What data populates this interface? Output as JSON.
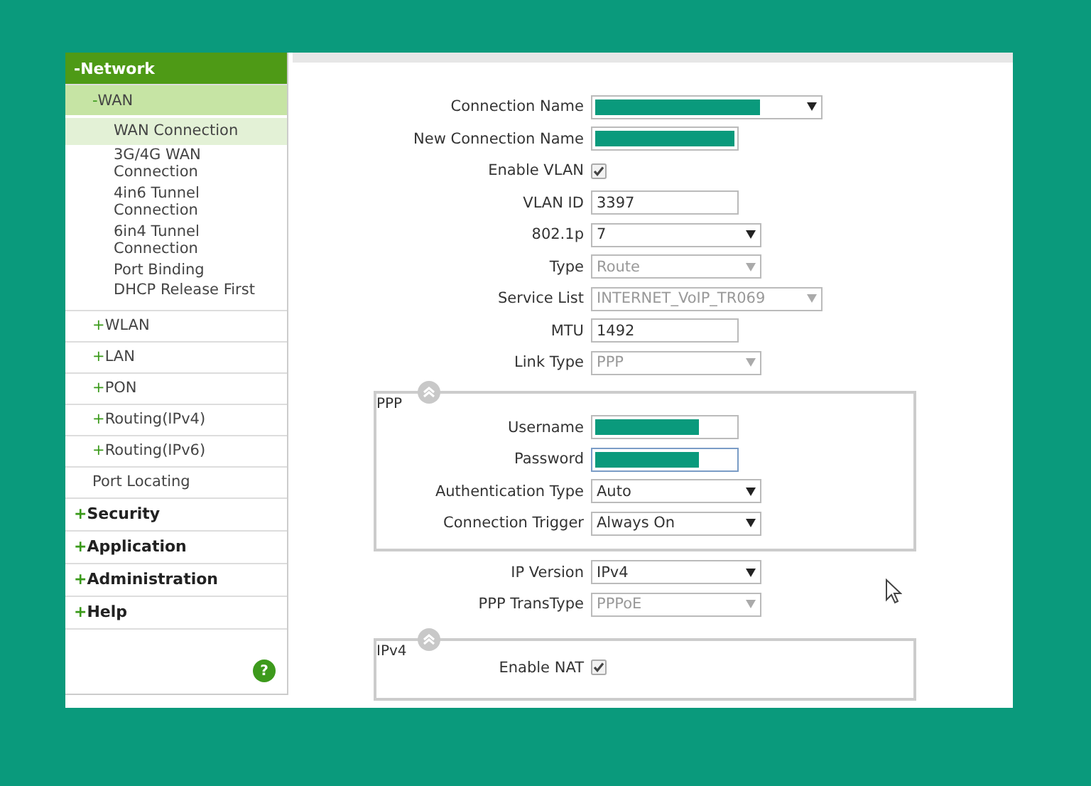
{
  "sidebar": {
    "items": [
      {
        "sign": "-",
        "label": "Network",
        "expanded": true,
        "children": [
          {
            "sign": "-",
            "label": "WAN",
            "expanded": true,
            "children": [
              {
                "label": "WAN Connection",
                "selected": true
              },
              {
                "label": "3G/4G WAN Connection",
                "selected": false
              },
              {
                "label": "4in6 Tunnel Connection",
                "selected": false
              },
              {
                "label": "6in4 Tunnel Connection",
                "selected": false
              },
              {
                "label": "Port Binding",
                "selected": false
              },
              {
                "label": "DHCP Release First",
                "selected": false
              }
            ]
          },
          {
            "sign": "+",
            "label": "WLAN",
            "expanded": false
          },
          {
            "sign": "+",
            "label": "LAN",
            "expanded": false
          },
          {
            "sign": "+",
            "label": "PON",
            "expanded": false
          },
          {
            "sign": "+",
            "label": "Routing(IPv4)",
            "expanded": false
          },
          {
            "sign": "+",
            "label": "Routing(IPv6)",
            "expanded": false
          },
          {
            "label": "Port Locating",
            "expanded": false
          }
        ]
      },
      {
        "sign": "+",
        "label": "Security",
        "expanded": false
      },
      {
        "sign": "+",
        "label": "Application",
        "expanded": false
      },
      {
        "sign": "+",
        "label": "Administration",
        "expanded": false
      },
      {
        "sign": "+",
        "label": "Help",
        "expanded": false
      }
    ],
    "help": "?"
  },
  "form": [
    {
      "kind": "fields",
      "fields": [
        {
          "label": "Connection Name",
          "kind": "select",
          "wide": true,
          "redacted": true,
          "disabled": false
        },
        {
          "label": "New Connection Name",
          "kind": "text",
          "wide": false,
          "redacted": true,
          "disabled": false,
          "focused": false
        },
        {
          "label": "Enable VLAN",
          "kind": "checkbox",
          "checked": true
        },
        {
          "label": "VLAN ID",
          "kind": "text",
          "value": "3397",
          "wide": false,
          "disabled": false,
          "focused": false
        },
        {
          "label": "802.1p",
          "kind": "select",
          "value": "7",
          "wide": false,
          "disabled": false
        },
        {
          "label": "Type",
          "kind": "select",
          "value": "Route",
          "wide": false,
          "disabled": true
        },
        {
          "label": "Service List",
          "kind": "select",
          "value": "INTERNET_VoIP_TR069",
          "wide": true,
          "disabled": true
        },
        {
          "label": "MTU",
          "kind": "text",
          "value": "1492",
          "wide": false,
          "disabled": false,
          "focused": false
        },
        {
          "label": "Link Type",
          "kind": "select",
          "value": "PPP",
          "wide": false,
          "disabled": true
        }
      ]
    },
    {
      "kind": "section",
      "title": "PPP",
      "expanded": true,
      "fields": [
        {
          "label": "Username",
          "kind": "text",
          "wide": false,
          "redacted": true,
          "disabled": false,
          "focused": false
        },
        {
          "label": "Password",
          "kind": "text",
          "wide": false,
          "redacted": true,
          "disabled": false,
          "focused": true
        },
        {
          "label": "Authentication Type",
          "kind": "select",
          "value": "Auto",
          "wide": false,
          "disabled": false
        },
        {
          "label": "Connection Trigger",
          "kind": "select",
          "value": "Always On",
          "wide": false,
          "disabled": false
        }
      ]
    },
    {
      "kind": "fields",
      "fields": [
        {
          "label": "IP Version",
          "kind": "select",
          "value": "IPv4",
          "wide": false,
          "disabled": false
        },
        {
          "label": "PPP TransType",
          "kind": "select",
          "value": "PPPoE",
          "wide": false,
          "disabled": true
        }
      ]
    },
    {
      "kind": "section",
      "title": "IPv4",
      "expanded": true,
      "fields": [
        {
          "label": "Enable NAT",
          "kind": "checkbox",
          "checked": true
        }
      ]
    }
  ]
}
